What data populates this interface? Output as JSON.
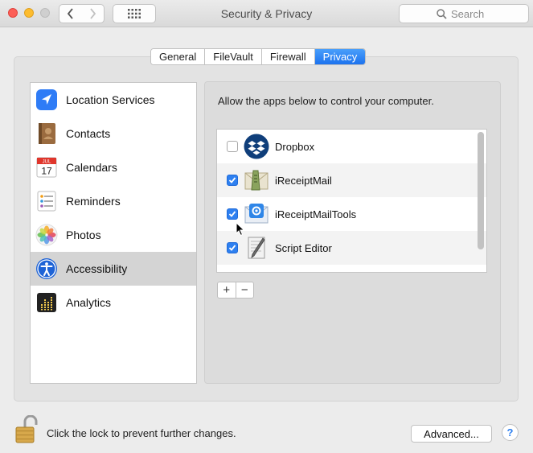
{
  "window": {
    "title": "Security & Privacy",
    "search_placeholder": "Search"
  },
  "tabs": [
    {
      "label": "General",
      "active": false
    },
    {
      "label": "FileVault",
      "active": false
    },
    {
      "label": "Firewall",
      "active": false
    },
    {
      "label": "Privacy",
      "active": true
    }
  ],
  "sidebar": {
    "items": [
      {
        "label": "Location Services",
        "icon": "location-arrow-icon",
        "selected": false
      },
      {
        "label": "Contacts",
        "icon": "contacts-book-icon",
        "selected": false
      },
      {
        "label": "Calendars",
        "icon": "calendar-icon",
        "selected": false,
        "icon_month": "JUL",
        "icon_day": "17"
      },
      {
        "label": "Reminders",
        "icon": "reminders-list-icon",
        "selected": false
      },
      {
        "label": "Photos",
        "icon": "photos-flower-icon",
        "selected": false
      },
      {
        "label": "Accessibility",
        "icon": "accessibility-person-icon",
        "selected": true
      },
      {
        "label": "Analytics",
        "icon": "analytics-bars-icon",
        "selected": false
      }
    ]
  },
  "main": {
    "description": "Allow the apps below to control your computer.",
    "apps": [
      {
        "name": "Dropbox",
        "checked": false,
        "icon": "dropbox-icon"
      },
      {
        "name": "iReceiptMail",
        "checked": true,
        "icon": "ireceiptmail-icon"
      },
      {
        "name": "iReceiptMailTools",
        "checked": true,
        "icon": "ireceiptmailtools-icon"
      },
      {
        "name": "Script Editor",
        "checked": true,
        "icon": "script-editor-icon"
      }
    ],
    "add_label": "+",
    "remove_label": "−"
  },
  "footer": {
    "lock_text": "Click the lock to prevent further changes.",
    "advanced_label": "Advanced...",
    "help_label": "?"
  },
  "colors": {
    "accent": "#2e80f0",
    "selected_row": "#d4d4d4",
    "close": "#fc5f57",
    "minimize": "#fdbc2e"
  }
}
